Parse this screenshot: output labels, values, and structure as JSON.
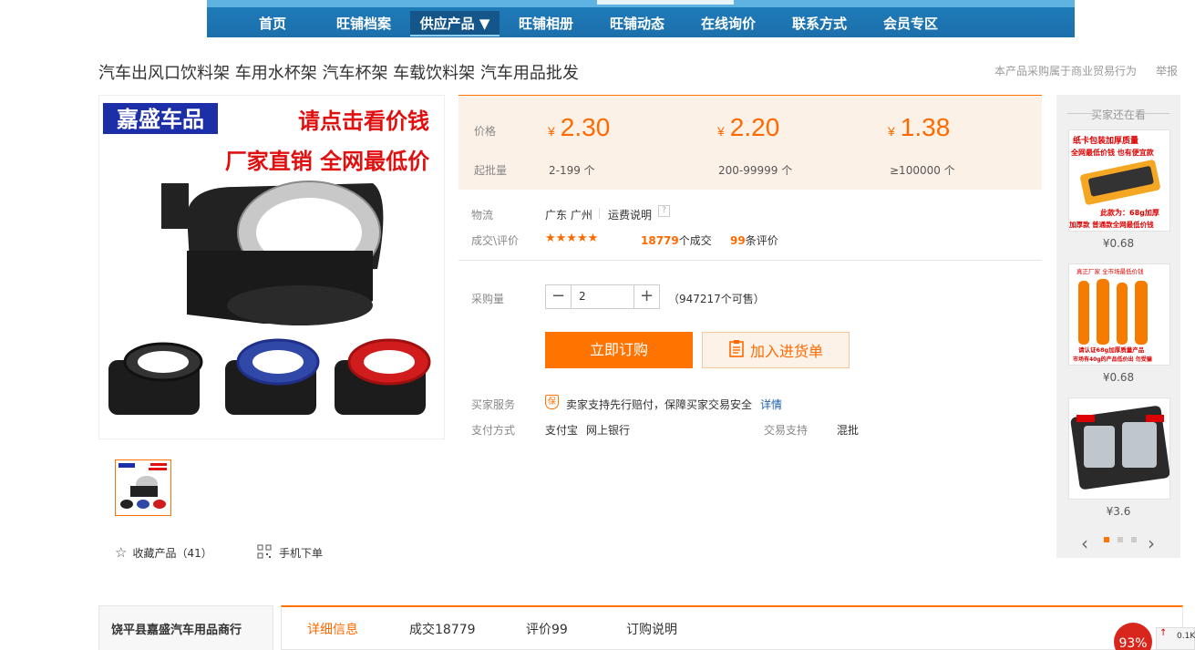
{
  "nav": {
    "items": [
      "首页",
      "旺铺档案",
      "供应产品 ▼",
      "旺铺相册",
      "旺铺动态",
      "在线询价",
      "联系方式",
      "会员专区"
    ],
    "active_index": 2
  },
  "product": {
    "title": "汽车出风口饮料架 车用水杯架 汽车杯架 车载饮料架 汽车用品批发",
    "notice": "本产品采购属于商业贸易行为",
    "report": "举报",
    "image_text": {
      "brand": "嘉盛车品",
      "click_price": "请点击看价钱",
      "slogan": "厂家直销 全网最低价"
    }
  },
  "favorite": {
    "label": "收藏产品（41）"
  },
  "mobile_order": {
    "label": "手机下单"
  },
  "price_box": {
    "price_label": "价格",
    "moq_label": "起批量",
    "currency": "¥",
    "tiers": [
      {
        "price": "2.30",
        "range": "2-199 个"
      },
      {
        "price": "2.20",
        "range": "200-99999 个"
      },
      {
        "price": "1.38",
        "range": "≥100000 个"
      }
    ]
  },
  "logistics": {
    "label": "物流",
    "location": "广东 广州",
    "shipping_link": "运费说明",
    "help_icon": "?"
  },
  "deals": {
    "label": "成交\\评价",
    "rating_stars": 4.5,
    "stars_text": "★★★★★",
    "deal_count": "18779",
    "deal_suffix": "个成交",
    "review_count": "99",
    "review_suffix": "条评价"
  },
  "purchase": {
    "label": "采购量",
    "minus": "−",
    "plus": "+",
    "quantity": "2",
    "stock_text": "（947217个可售）"
  },
  "buttons": {
    "buy_now": "立即订购",
    "add_cart": "加入进货单"
  },
  "service": {
    "label": "买家服务",
    "badge": "保",
    "text": "卖家支持先行赔付，保障买家交易安全",
    "details_link": "详情"
  },
  "payment": {
    "label": "支付方式",
    "methods": [
      "支付宝",
      "网上银行"
    ],
    "trade_label": "交易支持",
    "trade_value": "混批"
  },
  "side": {
    "title": "买家还在看",
    "items": [
      {
        "price": "¥0.68",
        "caption_top": "纸卡包装加厚质量",
        "caption_mid": "全网最低价钱 也有便宜款",
        "caption_bottom": "此款为：68g加厚",
        "caption_foot": "加厚款 普通款全网最低价钱"
      },
      {
        "price": "¥0.68",
        "caption_top": "真正厂家 全市场最低价钱",
        "caption_bottom": "请认证68g加厚质量产品",
        "caption_foot": "市场有40g的产品低价出 勿受骗"
      },
      {
        "price": "¥3.6"
      }
    ],
    "prev": "‹",
    "next": "›",
    "dots": 3,
    "active_dot": 0
  },
  "shop": {
    "name": "饶平县嘉盛汽车用品商行"
  },
  "tabs": [
    "详细信息",
    "成交18779",
    "评价99",
    "订购说明"
  ],
  "active_tab": 0,
  "widgets": {
    "percent": "93%",
    "speed": "0.1K"
  },
  "colors": {
    "accent": "#ff7300",
    "nav_blue": "#1b6fab",
    "price_bg": "#fcf1e7"
  }
}
